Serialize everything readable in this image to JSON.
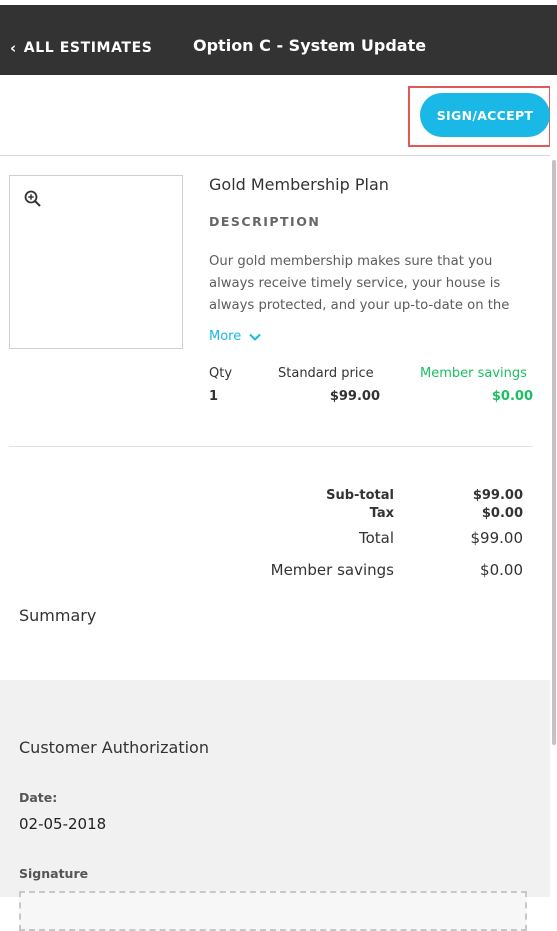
{
  "header": {
    "back_label": "ALL ESTIMATES",
    "title": "Option C - System Update"
  },
  "actions": {
    "sign_accept_label": "SIGN/ACCEPT"
  },
  "product": {
    "image_icon": "zoom-in-icon",
    "title": "Gold Membership Plan",
    "description_heading": "DESCRIPTION",
    "description_text": "Our gold membership makes sure that you always receive timely service, your house is always protected, and your up-to-date on the",
    "more_label": "More",
    "columns": {
      "qty_label": "Qty",
      "standard_price_label": "Standard price",
      "member_savings_label": "Member savings"
    },
    "values": {
      "qty": "1",
      "standard_price": "$99.00",
      "member_savings": "$0.00"
    }
  },
  "totals": {
    "subtotal_label": "Sub-total",
    "subtotal_value": "$99.00",
    "tax_label": "Tax",
    "tax_value": "$0.00",
    "total_label": "Total",
    "total_value": "$99.00",
    "member_savings_label": "Member savings",
    "member_savings_value": "$0.00"
  },
  "summary": {
    "heading": "Summary"
  },
  "authorization": {
    "heading": "Customer Authorization",
    "date_label": "Date:",
    "date_value": "02-05-2018",
    "signature_label": "Signature"
  },
  "colors": {
    "header_bg": "#333333",
    "accent": "#1ab8e6",
    "savings_green": "#1bbf62",
    "highlight": "#e05a5a"
  }
}
